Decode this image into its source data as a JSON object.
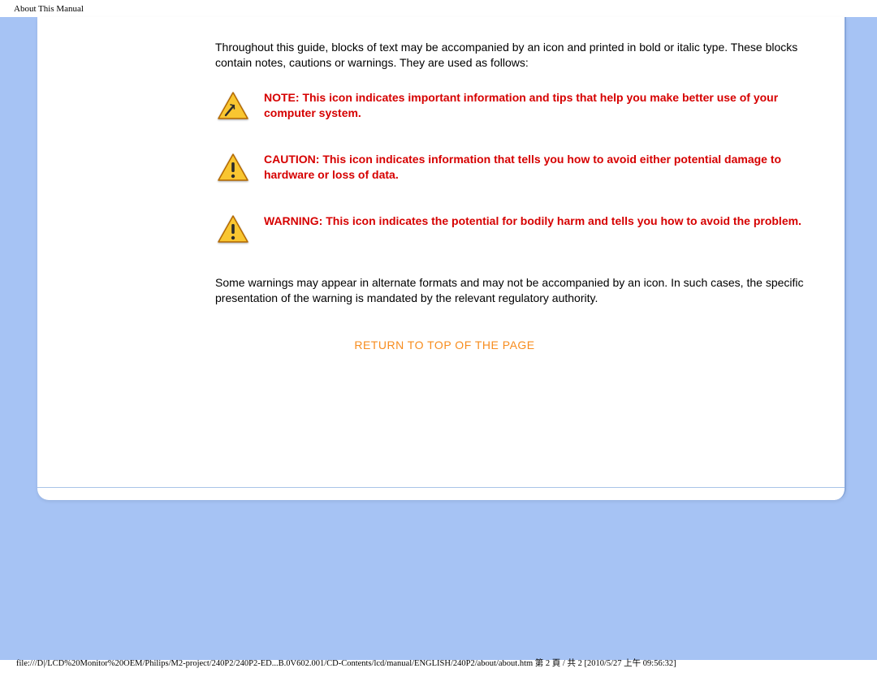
{
  "header": {
    "title": "About This Manual"
  },
  "content": {
    "intro": "Throughout this guide, blocks of text may be accompanied by an icon and printed in bold or italic type. These blocks contain notes, cautions or warnings. They are used as follows:",
    "callouts": [
      {
        "icon": "note-triangle-icon",
        "text": "NOTE: This icon indicates important information and tips that help you make better use of your computer system."
      },
      {
        "icon": "caution-triangle-icon",
        "text": "CAUTION: This icon indicates information that tells you how to avoid either potential damage to hardware or loss of data."
      },
      {
        "icon": "warning-triangle-icon",
        "text": "WARNING: This icon indicates the potential for bodily harm and tells you how to avoid the problem."
      }
    ],
    "outro": "Some warnings may appear in alternate formats and may not be accompanied by an icon. In such cases, the specific presentation of the warning is mandated by the relevant regulatory authority.",
    "return_link_label": "RETURN TO TOP OF THE PAGE"
  },
  "footer": {
    "path": "file:///D|/LCD%20Monitor%20OEM/Philips/M2-project/240P2/240P2-ED...B.0V602.001/CD-Contents/lcd/manual/ENGLISH/240P2/about/about.htm 第 2 頁 / 共 2 [2010/5/27 上午 09:56:32]"
  },
  "colors": {
    "background_blue": "#a6c3f4",
    "callout_red": "#d60000",
    "link_orange": "#f78c1e",
    "triangle_fill": "#f9c631",
    "triangle_stroke": "#b46900"
  }
}
